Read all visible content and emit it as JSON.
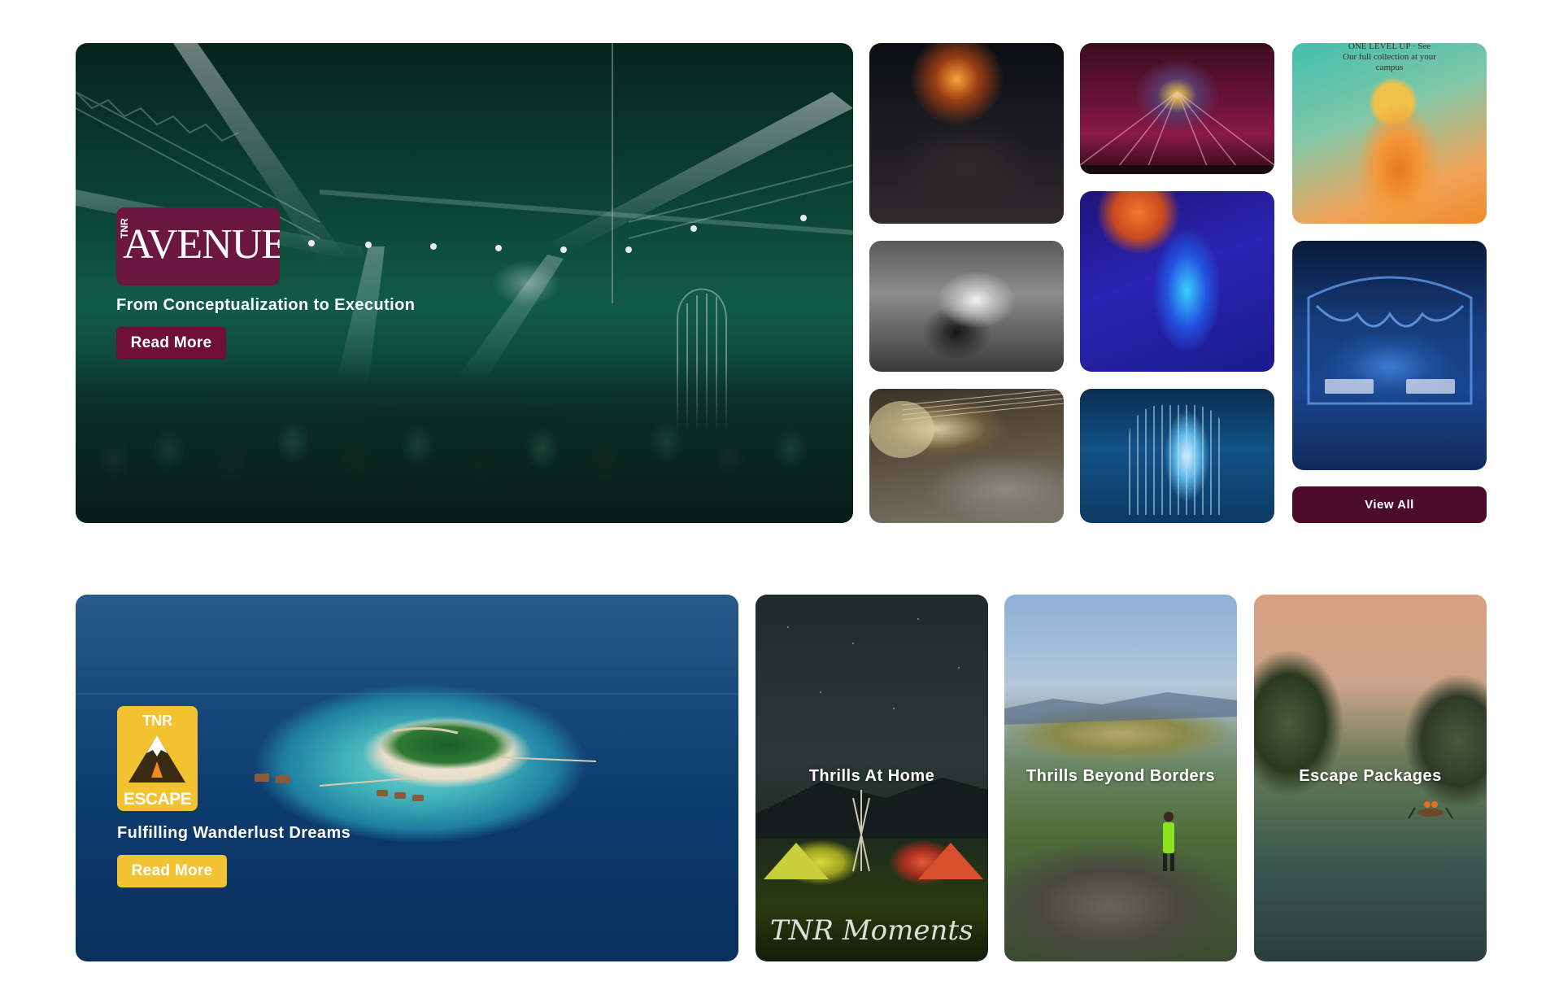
{
  "avenue": {
    "logo_prefix": "TNR",
    "logo_word": "AVENUE",
    "subtitle": "From Conceptualization to Execution",
    "read_more_label": "Read More",
    "view_all_label": "View All",
    "poster_text": "ONE LEVEL UP · See Our full collection at your campus"
  },
  "escape": {
    "logo_prefix": "TNR",
    "logo_word": "ESCAPE",
    "subtitle": "Fulfilling Wanderlust Dreams",
    "read_more_label": "Read More",
    "categories": [
      {
        "title": "Thrills At Home"
      },
      {
        "title": "Thrills Beyond Borders"
      },
      {
        "title": "Escape Packages"
      }
    ],
    "watermark": "TNR Moments"
  },
  "colors": {
    "avenue_brand": "#6e0f35",
    "view_all_bg": "#4c0b2b",
    "escape_accent": "#f2c435"
  }
}
